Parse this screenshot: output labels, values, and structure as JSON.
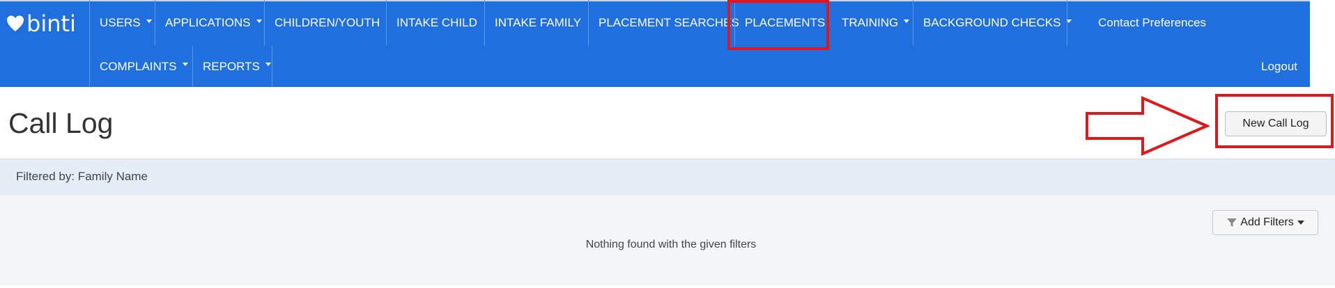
{
  "brand": {
    "name": "binti"
  },
  "nav": {
    "row1": [
      {
        "label": "USERS",
        "dropdown": true
      },
      {
        "label": "APPLICATIONS",
        "dropdown": true
      },
      {
        "label": "CHILDREN/YOUTH",
        "dropdown": false
      },
      {
        "label": "INTAKE CHILD",
        "dropdown": false
      },
      {
        "label": "INTAKE FAMILY",
        "dropdown": false
      },
      {
        "label": "PLACEMENT SEARCHES",
        "dropdown": false
      },
      {
        "label": "PLACEMENTS",
        "dropdown": false,
        "highlighted": true
      },
      {
        "label": "TRAINING",
        "dropdown": true
      },
      {
        "label": "BACKGROUND CHECKS",
        "dropdown": true
      }
    ],
    "row2": [
      {
        "label": "COMPLAINTS",
        "dropdown": true
      },
      {
        "label": "REPORTS",
        "dropdown": true
      }
    ],
    "contact_preferences": "Contact Preferences",
    "logout": "Logout"
  },
  "page": {
    "title": "Call Log",
    "new_button": "New Call Log",
    "filtered_by": "Filtered by: Family Name",
    "add_filters": "Add Filters",
    "empty_message": "Nothing found with the given filters"
  },
  "colors": {
    "nav_bg": "#1f6fdf",
    "annotation_red": "#e0181b",
    "filter_strip_bg": "#e5eef7"
  },
  "icons": [
    "heart-logo-icon",
    "caret-down-icon",
    "filter-funnel-icon",
    "arrow-right-annotation"
  ]
}
